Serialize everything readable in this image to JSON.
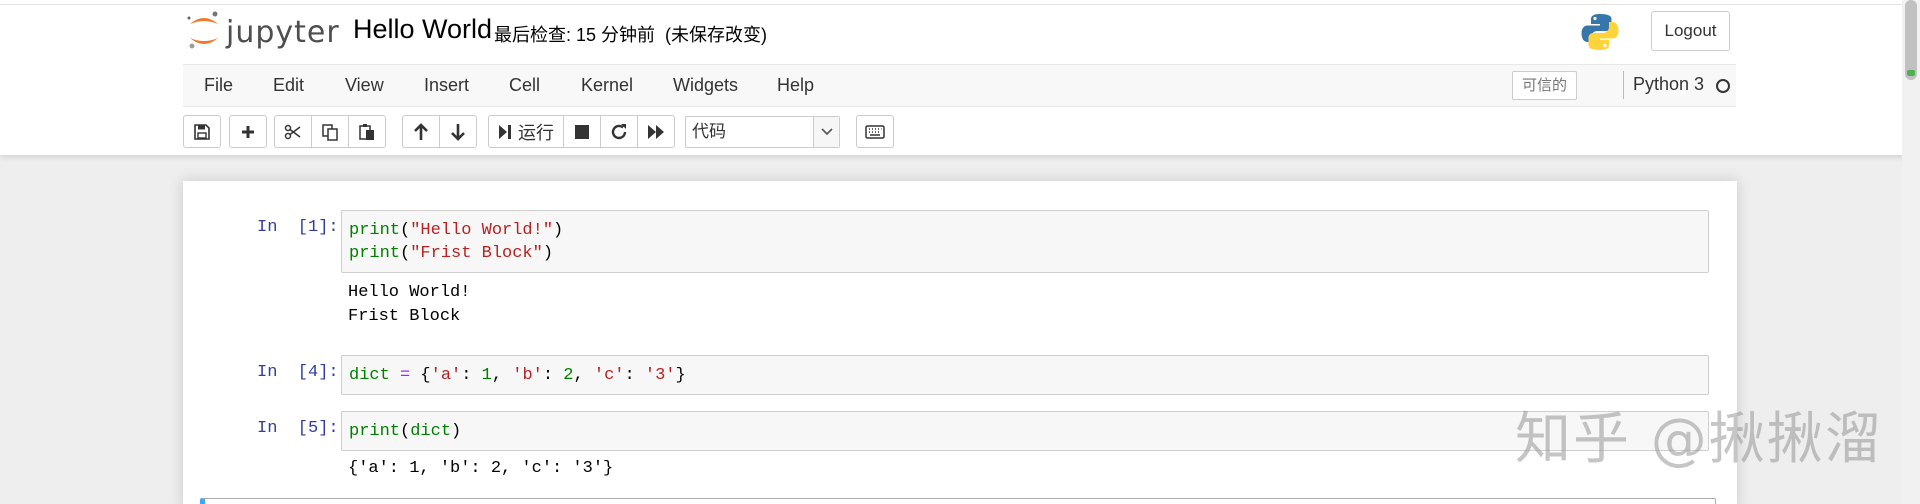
{
  "header": {
    "logo_text": "jupyter",
    "notebook_title": "Hello World",
    "checkpoint": "最后检查: 15 分钟前",
    "autosave": "(未保存改变)",
    "logout_label": "Logout"
  },
  "menubar": {
    "items": [
      "File",
      "Edit",
      "View",
      "Insert",
      "Cell",
      "Kernel",
      "Widgets",
      "Help"
    ],
    "trusted_label": "可信的",
    "kernel_name": "Python 3"
  },
  "toolbar": {
    "run_label": "运行",
    "cell_type": "代码",
    "buttons": [
      "save-icon",
      "plus-icon",
      "cut-icon",
      "copy-icon",
      "paste-icon",
      "arrow-up-icon",
      "arrow-down-icon",
      "step-forward-icon",
      "stop-icon",
      "restart-icon",
      "fast-forward-icon",
      "keyboard-icon"
    ]
  },
  "cells": [
    {
      "prompt": "In  [1]:",
      "code": [
        [
          {
            "t": "print",
            "c": "kw"
          },
          {
            "t": "(",
            "c": "pun"
          },
          {
            "t": "\"Hello World!\"",
            "c": "str"
          },
          {
            "t": ")",
            "c": "pun"
          }
        ],
        [
          {
            "t": "print",
            "c": "kw"
          },
          {
            "t": "(",
            "c": "pun"
          },
          {
            "t": "\"Frist Block\"",
            "c": "str"
          },
          {
            "t": ")",
            "c": "pun"
          }
        ]
      ],
      "output": [
        "Hello World!",
        "Frist Block"
      ]
    },
    {
      "prompt": "In  [4]:",
      "code": [
        [
          {
            "t": "dict",
            "c": "kw"
          },
          {
            "t": " ",
            "c": "pun"
          },
          {
            "t": "=",
            "c": "op"
          },
          {
            "t": " {",
            "c": "pun"
          },
          {
            "t": "'a'",
            "c": "str"
          },
          {
            "t": ": ",
            "c": "pun"
          },
          {
            "t": "1",
            "c": "num"
          },
          {
            "t": ", ",
            "c": "pun"
          },
          {
            "t": "'b'",
            "c": "str"
          },
          {
            "t": ": ",
            "c": "pun"
          },
          {
            "t": "2",
            "c": "num"
          },
          {
            "t": ", ",
            "c": "pun"
          },
          {
            "t": "'c'",
            "c": "str"
          },
          {
            "t": ": ",
            "c": "pun"
          },
          {
            "t": "'3'",
            "c": "str"
          },
          {
            "t": "}",
            "c": "pun"
          }
        ]
      ],
      "output": []
    },
    {
      "prompt": "In  [5]:",
      "code": [
        [
          {
            "t": "print",
            "c": "kw"
          },
          {
            "t": "(",
            "c": "pun"
          },
          {
            "t": "dict",
            "c": "kw"
          },
          {
            "t": ")",
            "c": "pun"
          }
        ]
      ],
      "output": [
        "{'a': 1, 'b': 2, 'c': '3'}"
      ]
    }
  ],
  "watermark": "知乎 @揪揪溜",
  "colors": {
    "prompt": "#303f9f",
    "keyword": "#008000",
    "string": "#ba2121",
    "operator": "#aa22ff",
    "selected_cell_border": "#42a5f5"
  }
}
